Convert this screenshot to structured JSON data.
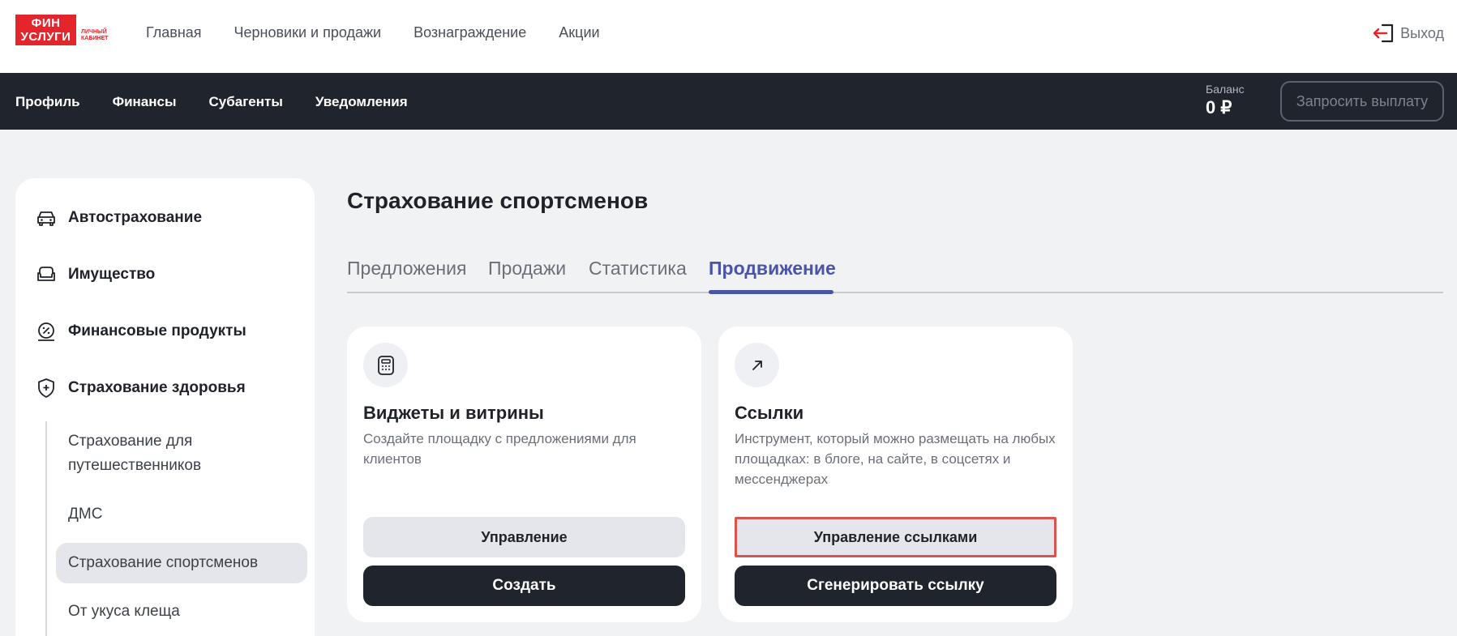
{
  "header": {
    "logo_line1": "ФИН",
    "logo_line2": "УСЛУГИ",
    "logo_sub1": "ЛИЧНЫЙ",
    "logo_sub2": "КАБИНЕТ",
    "nav": [
      "Главная",
      "Черновики и продажи",
      "Вознаграждение",
      "Акции"
    ],
    "logout_label": "Выход"
  },
  "subbar": {
    "nav": [
      "Профиль",
      "Финансы",
      "Субагенты",
      "Уведомления"
    ],
    "balance_label": "Баланс",
    "balance_value": "0 ₽",
    "payout_button": "Запросить выплату"
  },
  "sidebar": {
    "items": [
      {
        "label": "Автострахование",
        "icon": "car-icon"
      },
      {
        "label": "Имущество",
        "icon": "sofa-icon"
      },
      {
        "label": "Финансовые продукты",
        "icon": "percent-icon"
      },
      {
        "label": "Страхование здоровья",
        "icon": "shield-plus-icon"
      }
    ],
    "subitems": [
      "Страхование для путешественников",
      "ДМС",
      "Страхование спортсменов",
      "От укуса клеща"
    ],
    "active_subitem": "Страхование спортсменов"
  },
  "main": {
    "title": "Страхование спортсменов",
    "tabs": [
      "Предложения",
      "Продажи",
      "Статистика",
      "Продвижение"
    ],
    "active_tab": "Продвижение",
    "cards": [
      {
        "icon": "calculator-icon",
        "title": "Виджеты и витрины",
        "description": "Создайте площадку с предложениями для клиентов",
        "button_secondary": "Управление",
        "button_primary": "Создать"
      },
      {
        "icon": "arrow-up-right-icon",
        "title": "Ссылки",
        "description": "Инструмент, который можно размещать на любых площадках: в блоге, на сайте, в соцсетях и мессенджерах",
        "button_secondary": "Управление ссылками",
        "button_primary": "Сгенерировать ссылку"
      }
    ]
  },
  "colors": {
    "brand_red": "#e4252b",
    "dark_bar": "#1f242d",
    "accent": "#4a54a8",
    "highlight": "#d9534f"
  }
}
